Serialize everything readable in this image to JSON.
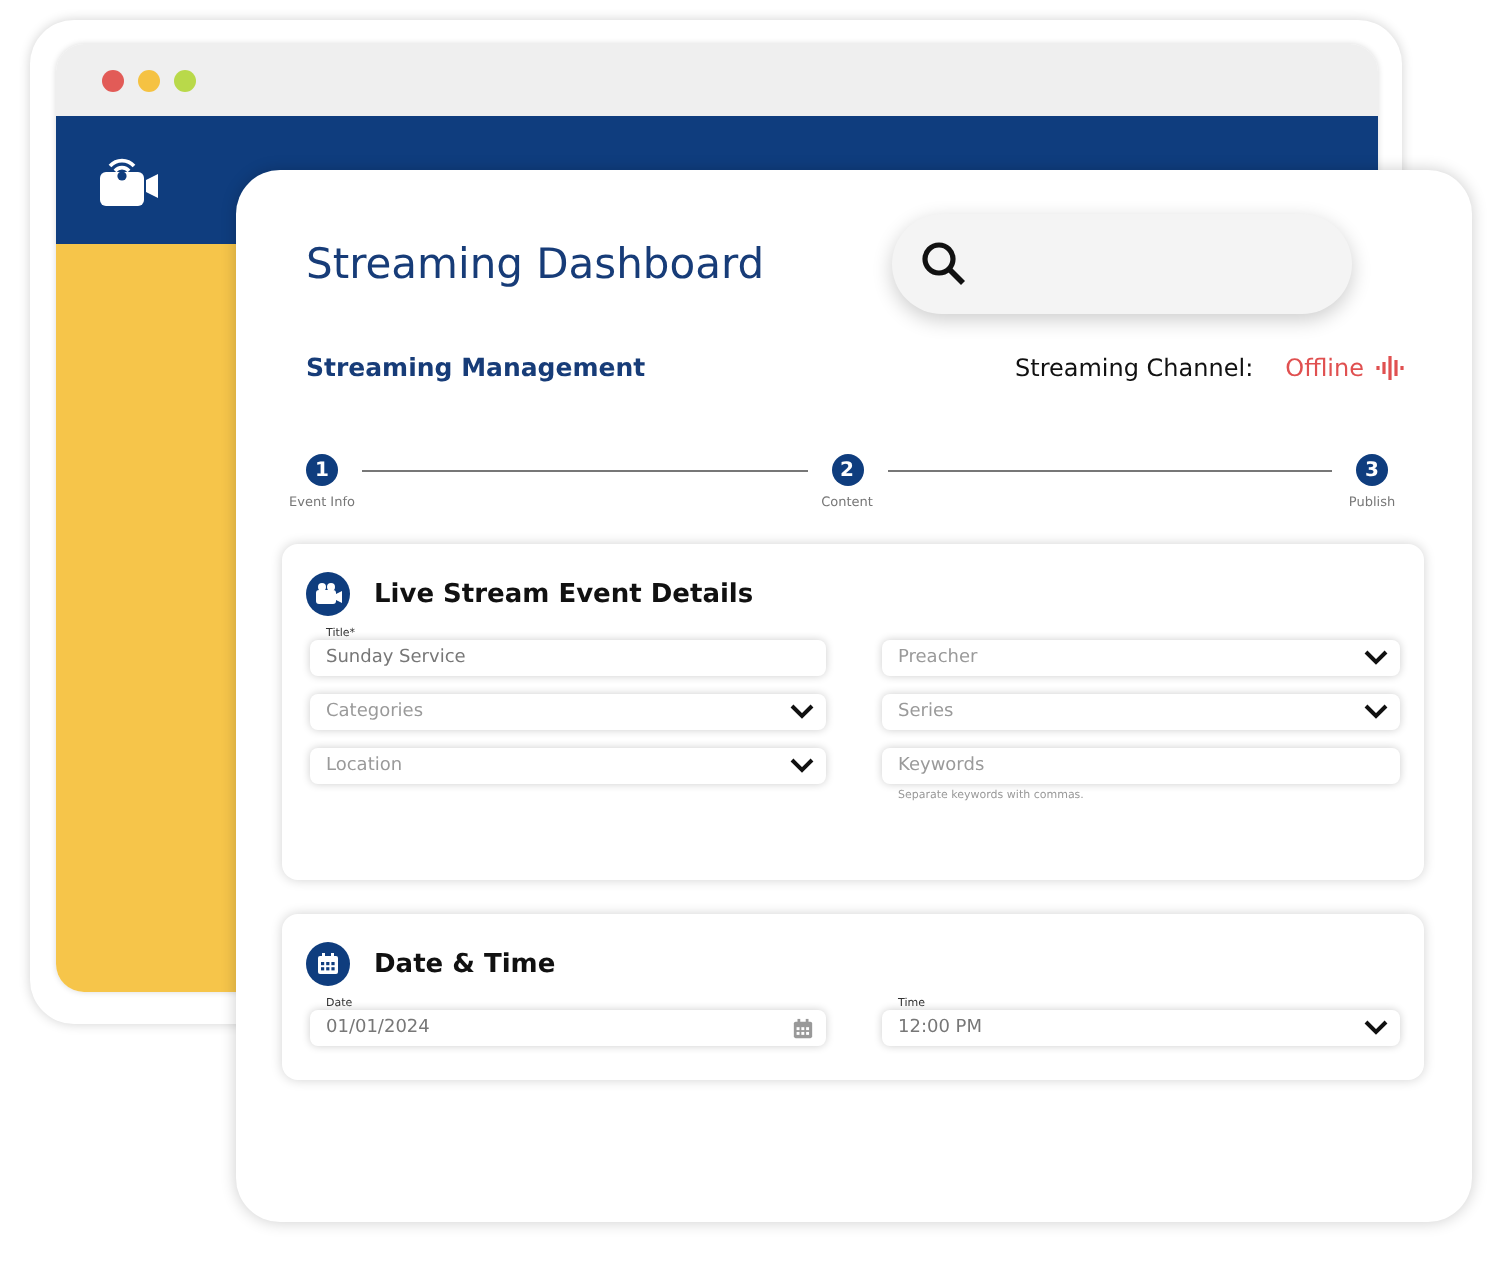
{
  "title": "Streaming Dashboard",
  "section_title": "Streaming Management",
  "channel": {
    "label": "Streaming Channel:",
    "status": "Offline"
  },
  "steps": [
    {
      "number": "1",
      "label": "Event Info"
    },
    {
      "number": "2",
      "label": "Content"
    },
    {
      "number": "3",
      "label": "Publish"
    }
  ],
  "event_details": {
    "title": "Live Stream Event Details",
    "fields": [
      {
        "kind": "text",
        "label": "Title*",
        "value": "Sunday Service"
      },
      {
        "kind": "select",
        "placeholder": "Preacher"
      },
      {
        "kind": "select",
        "placeholder": "Categories"
      },
      {
        "kind": "select",
        "placeholder": "Series"
      },
      {
        "kind": "select",
        "placeholder": "Location"
      },
      {
        "kind": "text",
        "placeholder": "Keywords",
        "hint": "Separate keywords with commas."
      }
    ]
  },
  "date_time": {
    "title": "Date & Time",
    "fields": [
      {
        "kind": "date",
        "label": "Date",
        "value": "01/01/2024"
      },
      {
        "kind": "select",
        "label": "Time",
        "value": "12:00 PM"
      }
    ]
  }
}
